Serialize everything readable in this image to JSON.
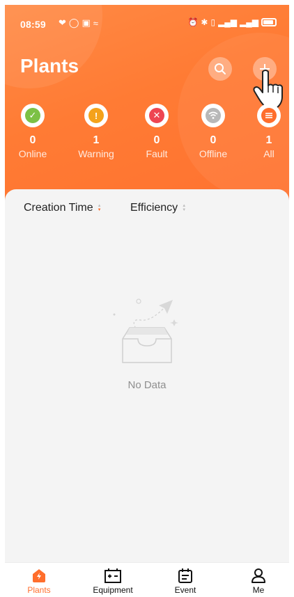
{
  "status_bar": {
    "time": "08:59"
  },
  "header": {
    "title": "Plants"
  },
  "stats": [
    {
      "key": "online",
      "count": "0",
      "label": "Online",
      "color": "#7cc145",
      "icon": "check-icon"
    },
    {
      "key": "warning",
      "count": "1",
      "label": "Warning",
      "color": "#f4a21b",
      "icon": "exclamation-icon"
    },
    {
      "key": "fault",
      "count": "0",
      "label": "Fault",
      "color": "#ee4552",
      "icon": "x-icon"
    },
    {
      "key": "offline",
      "count": "0",
      "label": "Offline",
      "color": "#b8b8b8",
      "icon": "wifi-icon"
    },
    {
      "key": "all",
      "count": "1",
      "label": "All",
      "color": "#ff6e2c",
      "icon": "list-icon"
    }
  ],
  "sort": {
    "creation_time": "Creation Time",
    "efficiency": "Efficiency"
  },
  "empty": {
    "message": "No Data"
  },
  "nav": [
    {
      "label": "Plants",
      "active": true
    },
    {
      "label": "Equipment",
      "active": false
    },
    {
      "label": "Event",
      "active": false
    },
    {
      "label": "Me",
      "active": false
    }
  ],
  "colors": {
    "accent": "#ff6e2c",
    "background": "#f4f4f4"
  }
}
